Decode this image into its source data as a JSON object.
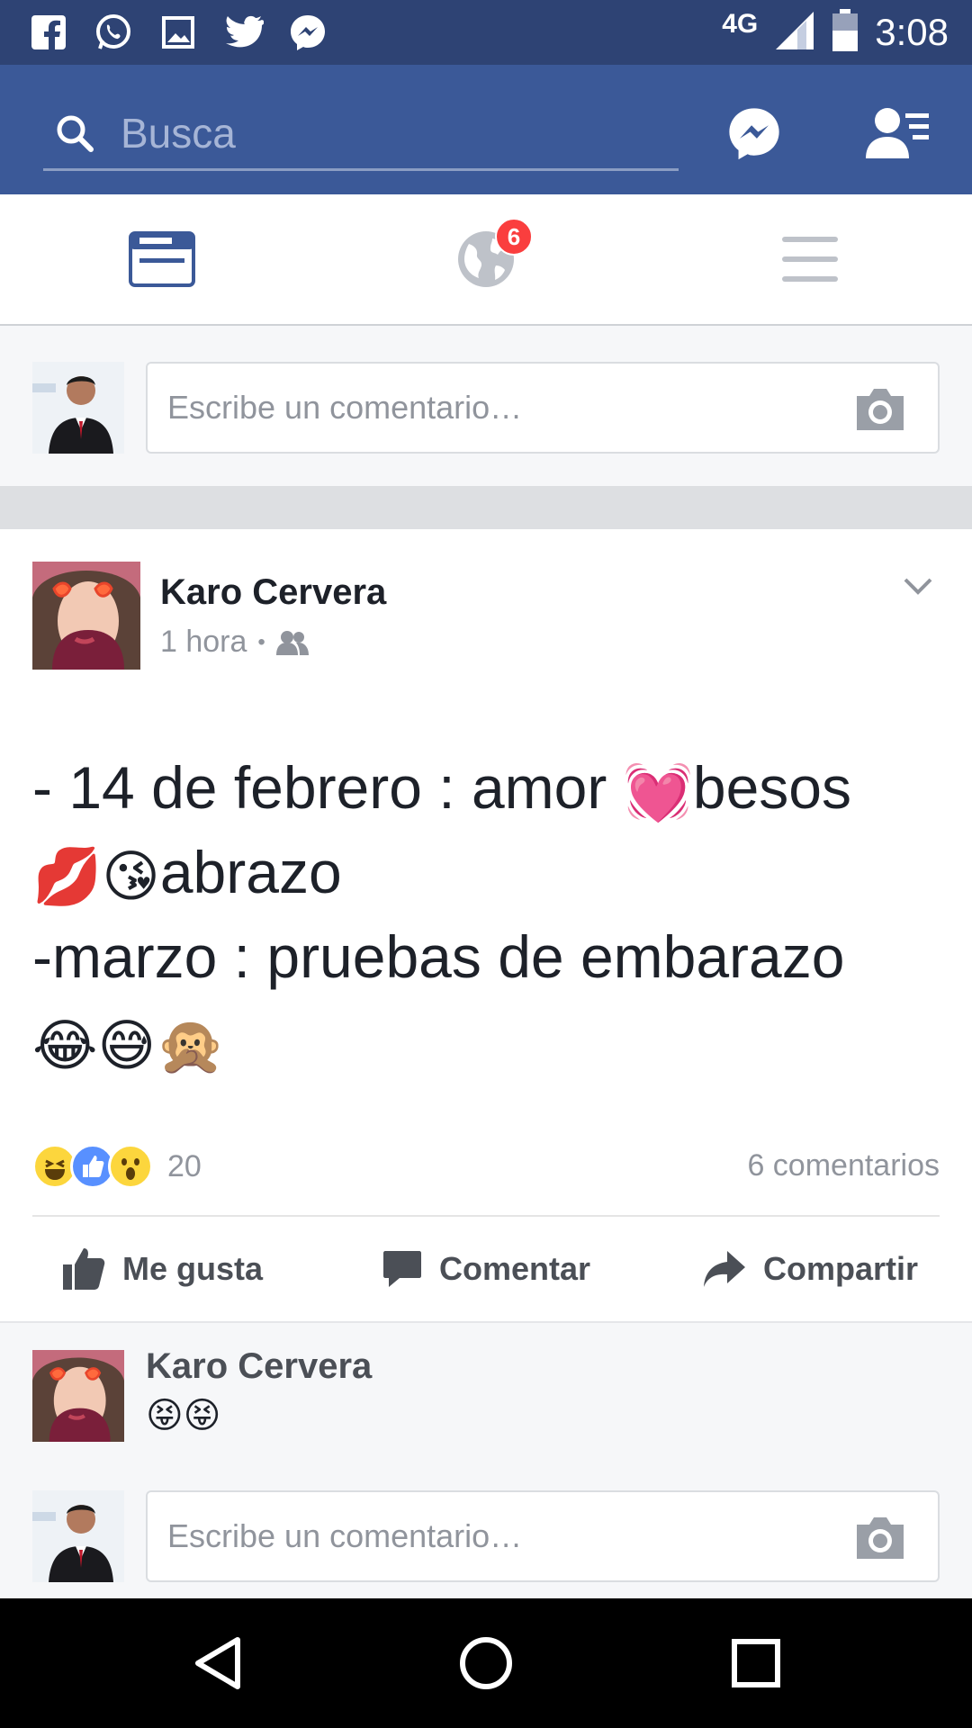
{
  "status_bar": {
    "network": "4G",
    "time": "3:08",
    "icons": [
      "facebook-icon",
      "whatsapp-icon",
      "gallery-icon",
      "twitter-icon",
      "messenger-icon"
    ]
  },
  "app_bar": {
    "search_placeholder": "Busca",
    "brand_color": "#3b5998"
  },
  "tabs": {
    "items": [
      "news-feed-icon",
      "notifications-globe-icon",
      "menu-icon"
    ],
    "notification_badge": "6"
  },
  "composer_top": {
    "placeholder": "Escribe un comentario…"
  },
  "post": {
    "author": "Karo Cervera",
    "time": "1 hora",
    "dot": "•",
    "line1_a": "- 14 de febrero : amor ",
    "line1_emoji": "💓",
    "line1_b": "besos",
    "line2_emoji1": "💋",
    "line2_emoji2": "😘",
    "line2_b": "abrazo",
    "line3": "-marzo : pruebas de embarazo",
    "line4_emoji1": "😂",
    "line4_emoji2": "😅",
    "line4_emoji3": "🙊",
    "reaction_count": "20",
    "comments_count": "6 comentarios",
    "actions": {
      "like": "Me gusta",
      "comment": "Comentar",
      "share": "Compartir"
    }
  },
  "comment": {
    "author": "Karo Cervera",
    "text": "😝😝"
  },
  "composer_bottom": {
    "placeholder": "Escribe un comentario…"
  }
}
